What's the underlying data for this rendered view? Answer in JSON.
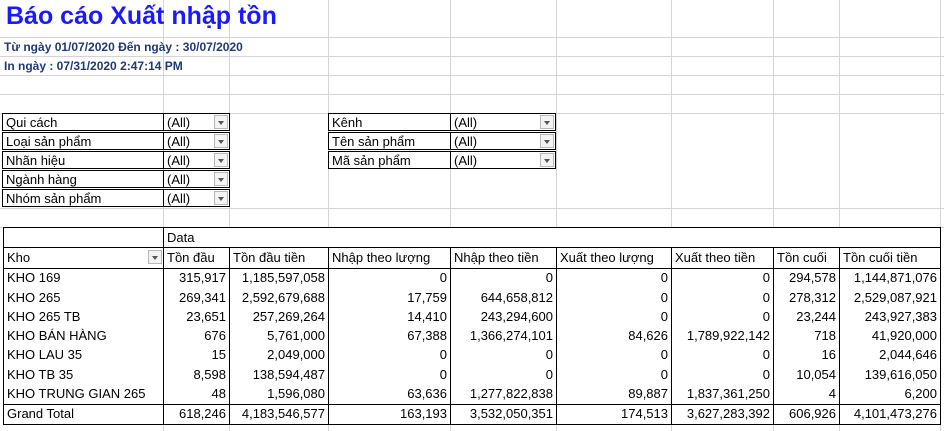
{
  "report": {
    "title": "Báo cáo Xuất nhập tồn",
    "date_range": "Từ ngày 01/07/2020 Đến ngày : 30/07/2020",
    "print_date": "In ngày : 07/31/2020 2:47:14 PM"
  },
  "filters_left": [
    {
      "label": "Qui cách",
      "value": "(All)"
    },
    {
      "label": "Loại sản phẩm",
      "value": "(All)"
    },
    {
      "label": "Nhãn hiệu",
      "value": "(All)"
    },
    {
      "label": "Ngành hàng",
      "value": "(All)"
    },
    {
      "label": "Nhóm sản phẩm",
      "value": "(All)"
    }
  ],
  "filters_right": [
    {
      "label": "Kênh",
      "value": "(All)"
    },
    {
      "label": "Tên sản phẩm",
      "value": "(All)"
    },
    {
      "label": "Mã sản phẩm",
      "value": "(All)"
    }
  ],
  "pivot": {
    "data_label": "Data",
    "row_field": "Kho",
    "columns": [
      "Tồn đầu",
      "Tồn đầu tiền",
      "Nhập theo lượng",
      "Nhập theo tiền",
      "Xuất theo lượng",
      "Xuất theo tiền",
      "Tồn cuối",
      "Tồn cuối tiền"
    ],
    "rows": [
      {
        "name": "KHO 169",
        "values": [
          "315,917",
          "1,185,597,058",
          "0",
          "0",
          "0",
          "0",
          "294,578",
          "1,144,871,076"
        ]
      },
      {
        "name": "KHO 265",
        "values": [
          "269,341",
          "2,592,679,688",
          "17,759",
          "644,658,812",
          "0",
          "0",
          "278,312",
          "2,529,087,921"
        ]
      },
      {
        "name": "KHO 265 TB",
        "values": [
          "23,651",
          "257,269,264",
          "14,410",
          "243,294,600",
          "0",
          "0",
          "23,244",
          "243,927,383"
        ]
      },
      {
        "name": "KHO BÁN HÀNG",
        "values": [
          "676",
          "5,761,000",
          "67,388",
          "1,366,274,101",
          "84,626",
          "1,789,922,142",
          "718",
          "41,920,000"
        ]
      },
      {
        "name": "KHO LAU 35",
        "values": [
          "15",
          "2,049,000",
          "0",
          "0",
          "0",
          "0",
          "16",
          "2,044,646"
        ]
      },
      {
        "name": "KHO TB 35",
        "values": [
          "8,598",
          "138,594,487",
          "0",
          "0",
          "0",
          "0",
          "10,054",
          "139,616,050"
        ]
      },
      {
        "name": "KHO TRUNG GIAN 265",
        "values": [
          "48",
          "1,596,080",
          "63,636",
          "1,277,822,838",
          "89,887",
          "1,837,361,250",
          "4",
          "6,200"
        ]
      }
    ],
    "total": {
      "name": "Grand Total",
      "values": [
        "618,246",
        "4,183,546,577",
        "163,193",
        "3,532,050,351",
        "174,513",
        "3,627,283,392",
        "606,926",
        "4,101,473,276"
      ]
    }
  }
}
